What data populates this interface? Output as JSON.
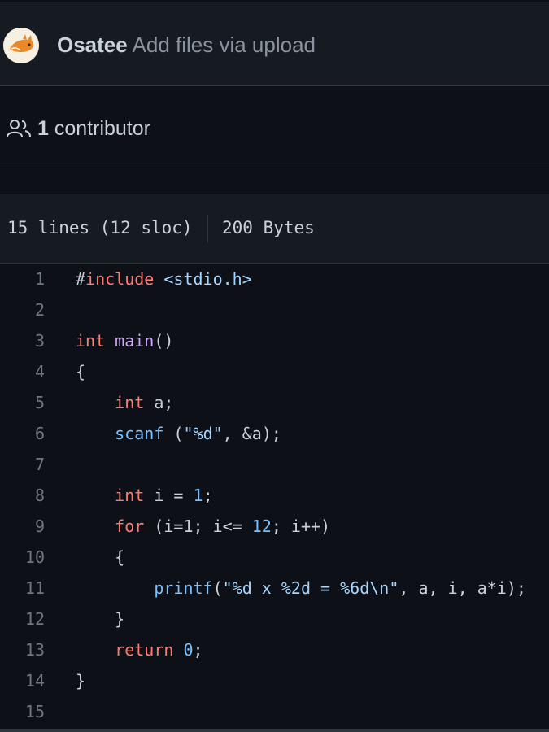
{
  "commit": {
    "author": "Osatee",
    "message": "Add files via upload"
  },
  "contributors": {
    "count": "1",
    "label": "contributor"
  },
  "file_info": {
    "lines": "15 lines (12 sloc)",
    "size": "200 Bytes"
  },
  "icons": {
    "avatar": "avatar-image",
    "contributors": "people-icon"
  },
  "colors": {
    "background": "#0d1117",
    "header_background": "#161b22",
    "keyword": "#ff7b72",
    "function": "#d2a8ff",
    "builtin": "#79c0ff",
    "string": "#a5d6ff",
    "line_number": "#6e7681",
    "text": "#c9d1d9"
  },
  "code": {
    "lines": [
      {
        "number": "1",
        "tokens": [
          {
            "t": "#",
            "c": "text"
          },
          {
            "t": "include",
            "c": "keyword"
          },
          {
            "t": " <stdio.h>",
            "c": "string"
          }
        ]
      },
      {
        "number": "2",
        "tokens": []
      },
      {
        "number": "3",
        "tokens": [
          {
            "t": "int",
            "c": "keyword"
          },
          {
            "t": " ",
            "c": "text"
          },
          {
            "t": "main",
            "c": "function"
          },
          {
            "t": "()",
            "c": "text"
          }
        ]
      },
      {
        "number": "4",
        "tokens": [
          {
            "t": "{",
            "c": "text"
          }
        ]
      },
      {
        "number": "5",
        "tokens": [
          {
            "t": "    ",
            "c": "text"
          },
          {
            "t": "int",
            "c": "keyword"
          },
          {
            "t": " a;",
            "c": "text"
          }
        ]
      },
      {
        "number": "6",
        "tokens": [
          {
            "t": "    ",
            "c": "text"
          },
          {
            "t": "scanf",
            "c": "builtin"
          },
          {
            "t": " (",
            "c": "text"
          },
          {
            "t": "\"%d\"",
            "c": "string"
          },
          {
            "t": ", &a);",
            "c": "text"
          }
        ]
      },
      {
        "number": "7",
        "tokens": []
      },
      {
        "number": "8",
        "tokens": [
          {
            "t": "    ",
            "c": "text"
          },
          {
            "t": "int",
            "c": "keyword"
          },
          {
            "t": " i = ",
            "c": "text"
          },
          {
            "t": "1",
            "c": "builtin"
          },
          {
            "t": ";",
            "c": "text"
          }
        ]
      },
      {
        "number": "9",
        "tokens": [
          {
            "t": "    ",
            "c": "text"
          },
          {
            "t": "for",
            "c": "keyword"
          },
          {
            "t": " (i=1; i<= ",
            "c": "text"
          },
          {
            "t": "12",
            "c": "builtin"
          },
          {
            "t": "; i++)",
            "c": "text"
          }
        ]
      },
      {
        "number": "10",
        "tokens": [
          {
            "t": "    {",
            "c": "text"
          }
        ]
      },
      {
        "number": "11",
        "tokens": [
          {
            "t": "        ",
            "c": "text"
          },
          {
            "t": "printf",
            "c": "builtin"
          },
          {
            "t": "(",
            "c": "text"
          },
          {
            "t": "\"%d x %2d = %6d\\n\"",
            "c": "string"
          },
          {
            "t": ", a, i, a*i);",
            "c": "text"
          }
        ]
      },
      {
        "number": "12",
        "tokens": [
          {
            "t": "    }",
            "c": "text"
          }
        ]
      },
      {
        "number": "13",
        "tokens": [
          {
            "t": "    ",
            "c": "text"
          },
          {
            "t": "return",
            "c": "keyword"
          },
          {
            "t": " ",
            "c": "text"
          },
          {
            "t": "0",
            "c": "builtin"
          },
          {
            "t": ";",
            "c": "text"
          }
        ]
      },
      {
        "number": "14",
        "tokens": [
          {
            "t": "}",
            "c": "text"
          }
        ]
      },
      {
        "number": "15",
        "tokens": []
      }
    ]
  }
}
